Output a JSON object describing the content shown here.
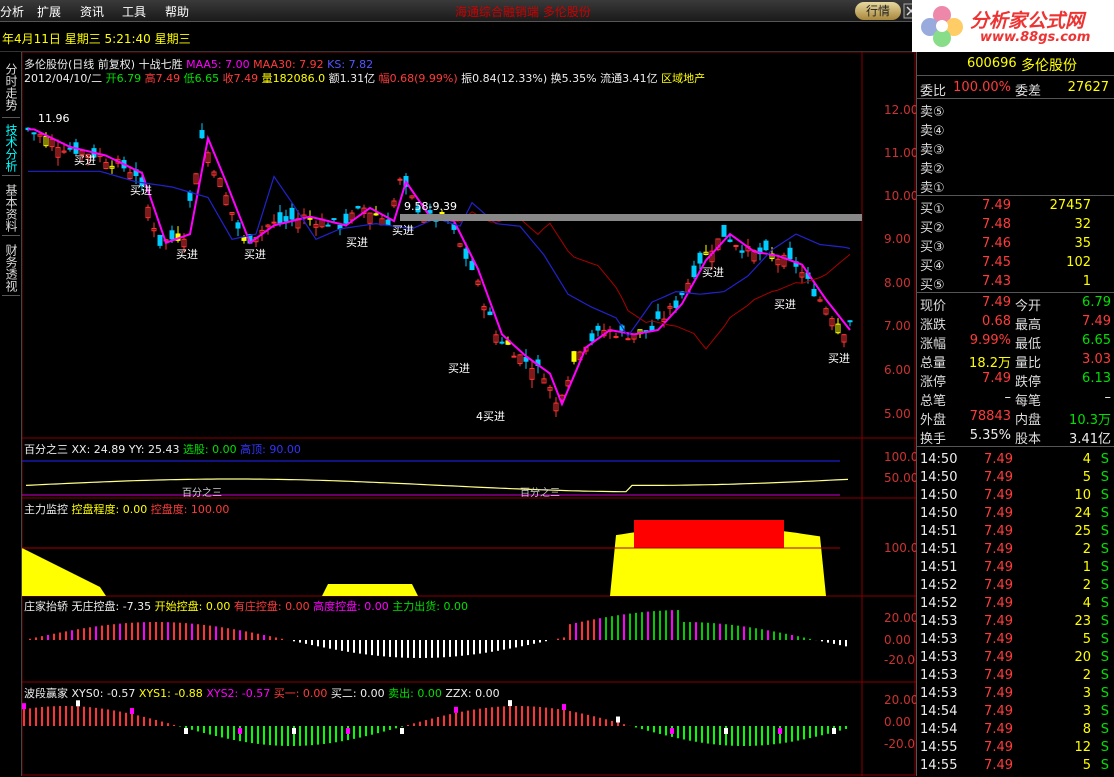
{
  "menu": {
    "items": [
      "分析",
      "扩展",
      "资讯",
      "工具",
      "帮助"
    ],
    "ticker": "海通综合融销端 多伦股份",
    "row_button": "行情"
  },
  "logo": {
    "title": "分析家公式网",
    "url": "www.88gs.com"
  },
  "date_line": "年4月11日  星期三  5:21:40 星期三",
  "left_tabs": [
    "分时走势",
    "技术分析",
    "基本资料",
    "财务透视"
  ],
  "main_chart": {
    "header1": {
      "name": "多伦股份(日线 前复权) 十战七胜",
      "maa5": "MAA5: 7.00",
      "maa30": "MAA30: 7.92",
      "ks": "KS: 7.82"
    },
    "header2": {
      "date": "2012/04/10/二",
      "open": "开6.79",
      "high": "高7.49",
      "low": "低6.65",
      "close": "收7.49",
      "vol": "量182086.0",
      "amt": "额1.31亿",
      "pct": "幅0.68(9.99%)",
      "amp": "振0.84(12.33%)",
      "turn": "换5.35%",
      "float": "流通3.41亿",
      "sector": "区域地产"
    },
    "y_ticks": [
      "12.00",
      "11.00",
      "10.00",
      "9.00",
      "8.00",
      "7.00",
      "6.00",
      "5.00"
    ],
    "annotations": {
      "peak": "11.96",
      "range": "9.58-9.39",
      "low_buy": "4买进",
      "buy": "买进"
    }
  },
  "panels": {
    "p1": {
      "name": "百分之三",
      "xx": "XX: 24.89",
      "yy": "YY: 25.43",
      "xg": "选股: 0.00",
      "gd": "高顶: 90.00",
      "ticks": [
        "100.0",
        "50.00"
      ],
      "mark": "百分之三"
    },
    "p2": {
      "name": "主力监控",
      "kp": "控盘程度: 0.00",
      "kpd": "控盘度: 100.00",
      "ticks": [
        "100.0"
      ]
    },
    "p3": {
      "name": "庄家抬轿",
      "wz": "无庄控盘: -7.35",
      "ks": "开始控盘: 0.00",
      "yz": "有庄控盘: 0.00",
      "gd": "高度控盘: 0.00",
      "zl": "主力出货: 0.00",
      "ticks": [
        "20.00",
        "0.00",
        "-20.0"
      ]
    },
    "p4": {
      "name": "波段赢家",
      "x0": "XYS0: -0.57",
      "x1": "XYS1: -0.88",
      "x2": "XYS2: -0.57",
      "b1": "买一: 0.00",
      "b2": "买二: 0.00",
      "sc": "卖出: 0.00",
      "zzx": "ZZX: 0.00",
      "ticks": [
        "20.00",
        "0.00",
        "-20.0"
      ]
    }
  },
  "quote": {
    "code": "600696",
    "name": "多伦股份",
    "weibi_label": "委比",
    "weibi": "100.00%",
    "weicha_label": "委差",
    "weicha": "27627",
    "sells": [
      "卖⑤",
      "卖④",
      "卖③",
      "卖②",
      "卖①"
    ],
    "buys": [
      {
        "l": "买①",
        "p": "7.49",
        "v": "27457"
      },
      {
        "l": "买②",
        "p": "7.48",
        "v": "32"
      },
      {
        "l": "买③",
        "p": "7.46",
        "v": "35"
      },
      {
        "l": "买④",
        "p": "7.45",
        "v": "102"
      },
      {
        "l": "买⑤",
        "p": "7.43",
        "v": "1"
      }
    ],
    "stats": [
      {
        "l1": "现价",
        "v1": "7.49",
        "c1": "red",
        "l2": "今开",
        "v2": "6.79",
        "c2": "green"
      },
      {
        "l1": "涨跌",
        "v1": "0.68",
        "c1": "red",
        "l2": "最高",
        "v2": "7.49",
        "c2": "red"
      },
      {
        "l1": "涨幅",
        "v1": "9.99%",
        "c1": "red",
        "l2": "最低",
        "v2": "6.65",
        "c2": "green"
      },
      {
        "l1": "总量",
        "v1": "18.2万",
        "c1": "yellow",
        "l2": "量比",
        "v2": "3.03",
        "c2": "red"
      },
      {
        "l1": "涨停",
        "v1": "7.49",
        "c1": "red",
        "l2": "跌停",
        "v2": "6.13",
        "c2": "green"
      },
      {
        "l1": "总笔",
        "v1": "–",
        "c1": "white",
        "l2": "每笔",
        "v2": "–",
        "c2": "white"
      },
      {
        "l1": "外盘",
        "v1": "78843",
        "c1": "red",
        "l2": "内盘",
        "v2": "10.3万",
        "c2": "green"
      },
      {
        "l1": "换手",
        "v1": "5.35%",
        "c1": "white",
        "l2": "股本",
        "v2": "3.41亿",
        "c2": "white"
      }
    ],
    "ticks": [
      {
        "t": "14:50",
        "p": "7.49",
        "v": "4",
        "s": "S"
      },
      {
        "t": "14:50",
        "p": "7.49",
        "v": "5",
        "s": "S"
      },
      {
        "t": "14:50",
        "p": "7.49",
        "v": "10",
        "s": "S"
      },
      {
        "t": "14:50",
        "p": "7.49",
        "v": "24",
        "s": "S"
      },
      {
        "t": "14:51",
        "p": "7.49",
        "v": "25",
        "s": "S"
      },
      {
        "t": "14:51",
        "p": "7.49",
        "v": "2",
        "s": "S"
      },
      {
        "t": "14:51",
        "p": "7.49",
        "v": "1",
        "s": "S"
      },
      {
        "t": "14:52",
        "p": "7.49",
        "v": "2",
        "s": "S"
      },
      {
        "t": "14:52",
        "p": "7.49",
        "v": "4",
        "s": "S"
      },
      {
        "t": "14:53",
        "p": "7.49",
        "v": "23",
        "s": "S"
      },
      {
        "t": "14:53",
        "p": "7.49",
        "v": "5",
        "s": "S"
      },
      {
        "t": "14:53",
        "p": "7.49",
        "v": "20",
        "s": "S"
      },
      {
        "t": "14:53",
        "p": "7.49",
        "v": "2",
        "s": "S"
      },
      {
        "t": "14:53",
        "p": "7.49",
        "v": "3",
        "s": "S"
      },
      {
        "t": "14:54",
        "p": "7.49",
        "v": "3",
        "s": "S"
      },
      {
        "t": "14:54",
        "p": "7.49",
        "v": "8",
        "s": "S"
      },
      {
        "t": "14:55",
        "p": "7.49",
        "v": "12",
        "s": "S"
      },
      {
        "t": "14:55",
        "p": "7.49",
        "v": "5",
        "s": "S"
      }
    ]
  }
}
